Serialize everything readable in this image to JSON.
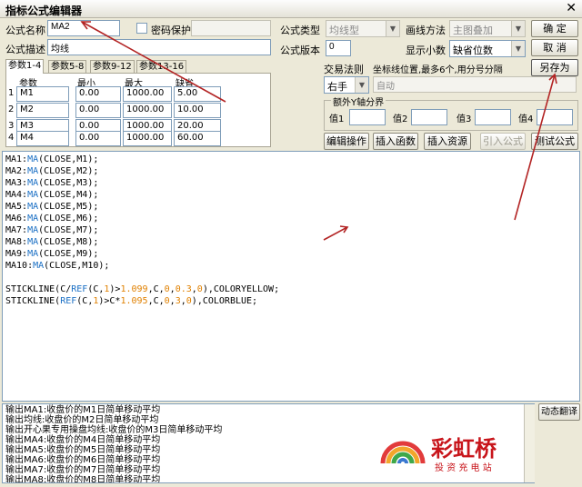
{
  "window": {
    "title": "指标公式编辑器",
    "close_glyph": "✕"
  },
  "formula": {
    "name_label": "公式名称",
    "name_value": "MA2",
    "password_label": "密码保护",
    "password_checked": false,
    "desc_label": "公式描述",
    "desc_value": "均线",
    "type_label": "公式类型",
    "type_value": "均线型",
    "draw_label": "画线方法",
    "draw_value": "主图叠加",
    "version_label": "公式版本",
    "version_value": "0",
    "decimal_label": "显示小数",
    "decimal_value": "缺省位数"
  },
  "buttons": {
    "ok": "确 定",
    "cancel": "取 消",
    "save_as": "另存为",
    "edit_ops": "编辑操作",
    "insert_fn": "插入函数",
    "insert_res": "插入资源",
    "import": "引入公式",
    "test": "测试公式",
    "translate": "动态翻译"
  },
  "tabs": [
    {
      "label": "参数1-4",
      "active": true
    },
    {
      "label": "参数5-8",
      "active": false
    },
    {
      "label": "参数9-12",
      "active": false
    },
    {
      "label": "参数13-16",
      "active": false
    }
  ],
  "params": {
    "headers": [
      "参数",
      "最小",
      "最大",
      "缺省"
    ],
    "rows": [
      {
        "n": "1",
        "name": "M1",
        "min": "0.00",
        "max": "1000.00",
        "def": "5.00"
      },
      {
        "n": "2",
        "name": "M2",
        "min": "0.00",
        "max": "1000.00",
        "def": "10.00"
      },
      {
        "n": "3",
        "name": "M3",
        "min": "0.00",
        "max": "1000.00",
        "def": "20.00"
      },
      {
        "n": "4",
        "name": "M4",
        "min": "0.00",
        "max": "1000.00",
        "def": "60.00"
      }
    ]
  },
  "trade": {
    "rule_label": "交易法则",
    "hint": "坐标线位置,最多6个,用分号分隔",
    "hand_value": "右手",
    "auto_value": "自动"
  },
  "yaxis": {
    "title": "额外Y轴分界",
    "labels": [
      "值1",
      "值2",
      "值3",
      "值4"
    ]
  },
  "code_lines": [
    "MA1:MA(CLOSE,M1);",
    "MA2:MA(CLOSE,M2);",
    "MA3:MA(CLOSE,M3);",
    "MA4:MA(CLOSE,M4);",
    "MA5:MA(CLOSE,M5);",
    "MA6:MA(CLOSE,M6);",
    "MA7:MA(CLOSE,M7);",
    "MA8:MA(CLOSE,M8);",
    "MA9:MA(CLOSE,M9);",
    "MA10:MA(CLOSE,M10);",
    "",
    "STICKLINE(C/REF(C,1)>1.099,C,0,0.3,0),COLORYELLOW;",
    "STICKLINE(REF(C,1)>C*1.095,C,0,3,0),COLORBLUE;"
  ],
  "output_lines": [
    "输出MA1:收盘价的M1日简单移动平均",
    "输出均线:收盘价的M2日简单移动平均",
    "输出开心果专用操盘均线:收盘价的M3日简单移动平均",
    "输出MA4:收盘价的M4日简单移动平均",
    "输出MA5:收盘价的M5日简单移动平均",
    "输出MA6:收盘价的M6日简单移动平均",
    "输出MA7:收盘价的M7日简单移动平均",
    "输出MA8:收盘价的M8日简单移动平均"
  ],
  "watermark": {
    "brand": "彩虹桥",
    "tagline": "投 资 充 电 站"
  },
  "colors": {
    "accent_red": "#b32424",
    "number": "#e08000",
    "function": "#1a6fc4"
  }
}
